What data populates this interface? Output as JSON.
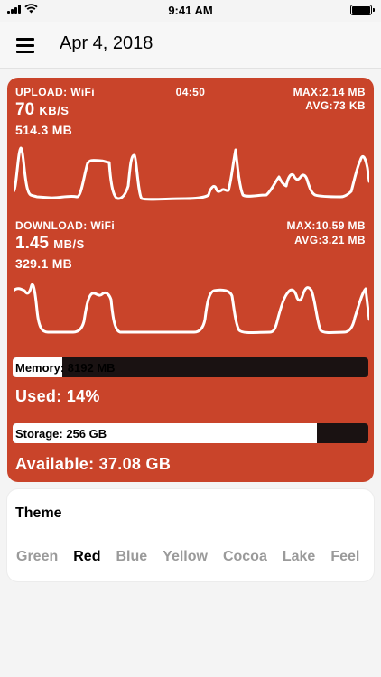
{
  "status_bar": {
    "time": "9:41 AM"
  },
  "header": {
    "title": "Apr 4, 2018"
  },
  "upload": {
    "label": "UPLOAD: WiFi",
    "elapsed": "04:50",
    "max": "MAX:2.14 MB",
    "avg": "AVG:73 KB",
    "rate_value": "70",
    "rate_unit": "KB/S",
    "total": "514.3 MB"
  },
  "download": {
    "label": "DOWNLOAD: WiFi",
    "max": "MAX:10.59 MB",
    "avg": "AVG:3.21 MB",
    "rate_value": "1.45",
    "rate_unit": "MB/S",
    "total": "329.1 MB"
  },
  "memory": {
    "label": "Memory: 8192 MB",
    "used_label": "Used: 14%",
    "used_fraction": 0.14
  },
  "storage": {
    "label": "Storage: 256 GB",
    "available_label": "Available: 37.08 GB",
    "used_fraction": 0.855
  },
  "theme": {
    "title": "Theme",
    "options": [
      "Green",
      "Red",
      "Blue",
      "Yellow",
      "Cocoa",
      "Lake",
      "Feel"
    ],
    "selected": "Red"
  },
  "colors": {
    "accent": "#c9442a",
    "bar_track": "#1a1212",
    "inactive_text": "#9a9a9a"
  }
}
